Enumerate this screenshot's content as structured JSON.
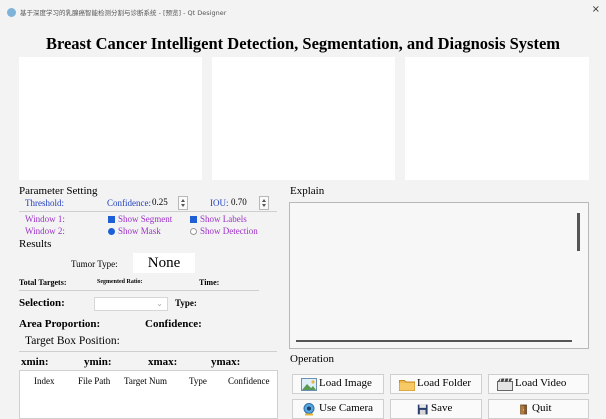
{
  "window": {
    "title": "基于深度学习的乳腺癌智能检测分割与诊断系统 - [预览] - Qt Designer",
    "close_glyph": "×"
  },
  "main_title": "Breast Cancer Intelligent Detection, Segmentation, and Diagnosis System",
  "parameter_setting": {
    "title": "Parameter Setting",
    "threshold_label": "Threshold:",
    "confidence_label": "Confidence:",
    "confidence_value": "0.25",
    "iou_label": "IOU:",
    "iou_value": "0.70",
    "window1_label": "Window 1:",
    "show_segment": "Show Segment",
    "show_labels": "Show Labels",
    "window2_label": "Window 2:",
    "show_mask": "Show Mask",
    "show_detection": "Show Detection"
  },
  "results": {
    "title": "Results",
    "tumor_type_label": "Tumor Type:",
    "tumor_type_value": "None",
    "total_targets_label": "Total Targets:",
    "segmented_ratio_label": "Segmented Ratio:",
    "time_label": "Time:",
    "selection_label": "Selection:",
    "selection_value": "",
    "combo_chevron": "⌄",
    "type_label": "Type:",
    "area_proportion_label": "Area Proportion:",
    "confidence_label": "Confidence:",
    "target_box_title": "Target Box Position:",
    "xmin_label": "xmin:",
    "ymin_label": "ymin:",
    "xmax_label": "xmax:",
    "ymax_label": "ymax:"
  },
  "table": {
    "columns": [
      "Index",
      "File Path",
      "Target Num",
      "Type",
      "Confidence"
    ]
  },
  "explain": {
    "title": "Explain"
  },
  "operation": {
    "title": "Operation",
    "load_image": "Load Image",
    "load_folder": "Load Folder",
    "load_video": "Load Video",
    "use_camera": "Use Camera",
    "save": "Save",
    "quit": "Quit"
  },
  "colors": {
    "blue_text": "#1f3fbf",
    "purple_text": "#9b2fc8",
    "checkbox_accent": "#1f5fd6"
  },
  "icons": [
    "app-icon",
    "spin-up-icon",
    "spin-down-icon",
    "image-icon",
    "folder-icon",
    "video-icon",
    "camera-icon",
    "save-icon",
    "quit-icon"
  ]
}
